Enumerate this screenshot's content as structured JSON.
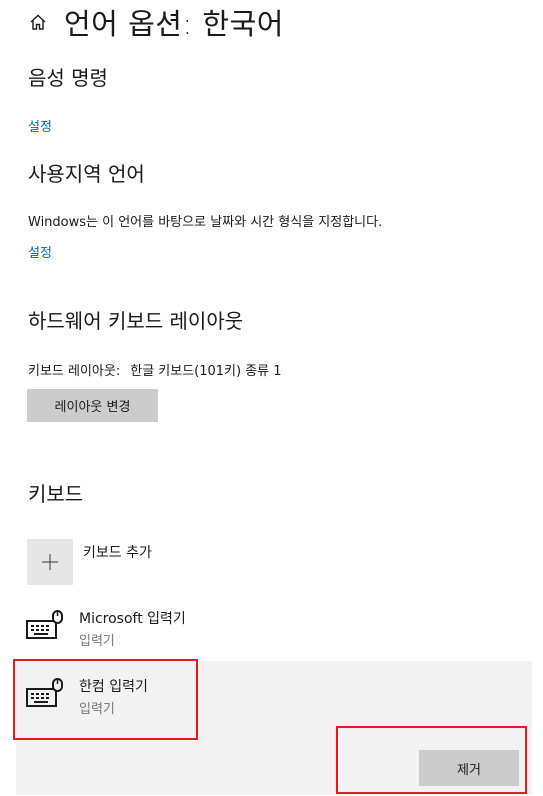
{
  "header": {
    "title": "언어 옵션: 한국어",
    "icon": "home-icon"
  },
  "voice": {
    "title": "음성 명령",
    "settings_link": "설정"
  },
  "regional": {
    "title": "사용지역 언어",
    "description": "Windows는 이 언어를 바탕으로 날짜와 시간 형식을 지정합니다.",
    "settings_link": "설정"
  },
  "hardware_keyboard": {
    "title": "하드웨어 키보드 레이아웃",
    "layout_label": "키보드 레이아웃:",
    "layout_value": "한글 키보드(101키) 종류 1",
    "change_button": "레이아웃 변경"
  },
  "keyboards": {
    "title": "키보드",
    "add_label": "키보드 추가",
    "items": [
      {
        "name": "Microsoft 입력기",
        "type": "입력기",
        "icon": "keyboard-icon",
        "selected": false
      },
      {
        "name": "한컴 입력기",
        "type": "입력기",
        "icon": "keyboard-icon",
        "selected": true
      }
    ],
    "remove_button": "제거"
  },
  "colors": {
    "link": "#0067b8",
    "highlight": "#e31b23",
    "button": "#cccccc",
    "selected_bg": "#f2f2f2"
  }
}
